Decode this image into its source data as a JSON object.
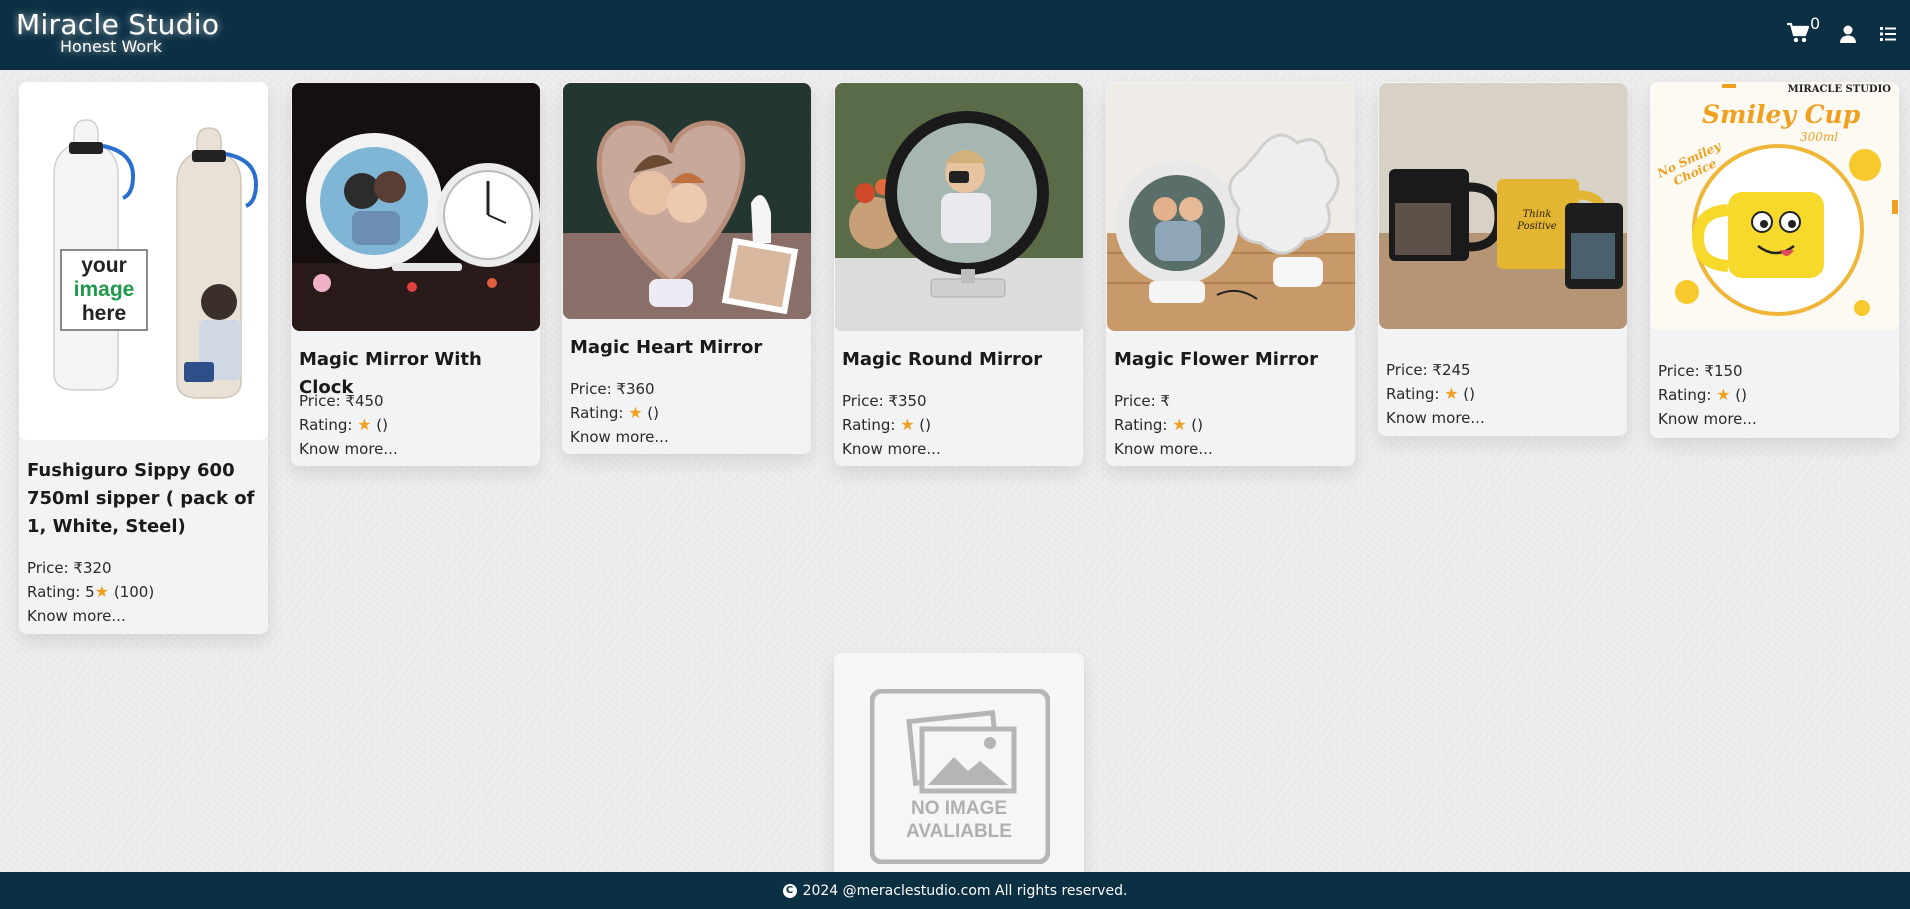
{
  "brand": {
    "title": "Miracle Studio",
    "subtitle": "Honest Work"
  },
  "header": {
    "cart_count": "0",
    "icons": [
      "cart-icon",
      "user-icon",
      "menu-list-icon"
    ]
  },
  "products": [
    {
      "name": "Fushiguro Sippy 600 750ml sipper ( pack of 1, White, Steel)",
      "price": "Price: ₹320",
      "rating_prefix": "Rating: 5",
      "rating_suffix": " (100)",
      "link": "Know more..."
    },
    {
      "name": "Magic Mirror With Clock",
      "price": "Price: ₹450",
      "rating_prefix": "Rating: ",
      "rating_suffix": " ()",
      "link": "Know more..."
    },
    {
      "name": "Magic Heart Mirror",
      "price": "Price: ₹360",
      "rating_prefix": "Rating: ",
      "rating_suffix": " ()",
      "link": "Know more..."
    },
    {
      "name": "Magic Round Mirror",
      "price": "Price: ₹350",
      "rating_prefix": "Rating: ",
      "rating_suffix": " ()",
      "link": "Know more..."
    },
    {
      "name": "Magic Flower Mirror",
      "price": "Price: ₹",
      "rating_prefix": "Rating: ",
      "rating_suffix": " ()",
      "link": "Know more..."
    },
    {
      "name": "",
      "price": "Price: ₹245",
      "rating_prefix": "Rating: ",
      "rating_suffix": " ()",
      "link": "Know more..."
    },
    {
      "name": "",
      "price": "Price: ₹150",
      "rating_prefix": "Rating: ",
      "rating_suffix": " ()",
      "link": "Know more..."
    }
  ],
  "image_text": {
    "bottle_line1": "your",
    "bottle_line2": "image",
    "bottle_line3": "here",
    "cup_brand": "MIRACLE STUDIO",
    "cup_title": "Smiley Cup",
    "cup_size": "300ml",
    "cup_tag": "No Smiley Choice",
    "mug_text": "Think Positive"
  },
  "placeholder": {
    "line1": "NO IMAGE",
    "line2": "AVALIABLE"
  },
  "footer": {
    "text": "2024 @meraclestudio.com All rights reserved."
  },
  "colors": {
    "header_bg": "#0b2f43",
    "star": "#f0a020",
    "card_bg": "#f2f3f5"
  }
}
